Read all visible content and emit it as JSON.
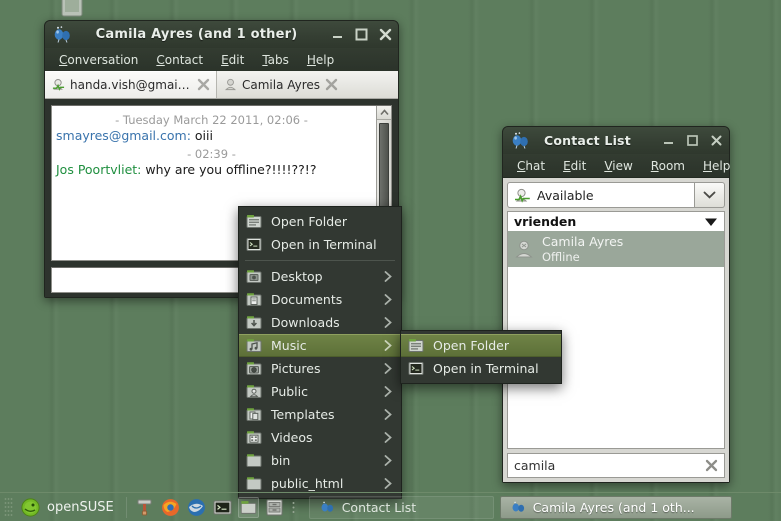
{
  "desktop": {
    "trash_icon": "trash-bin-icon",
    "wallpaper_color": "#5d7d5d"
  },
  "chat_window": {
    "app_icon": "pidgin-balloons-icon",
    "title": "Camila Ayres (and 1 other)",
    "window_buttons": [
      {
        "name": "minimize-button",
        "glyph": "minimize-icon"
      },
      {
        "name": "maximize-button",
        "glyph": "maximize-icon"
      },
      {
        "name": "close-button",
        "glyph": "close-icon"
      }
    ],
    "menus": [
      {
        "accel": "C",
        "rest": "onversation"
      },
      {
        "accel": "C",
        "rest": "ontact",
        "pre": "C",
        "label": "Contact"
      },
      {
        "accel": "E",
        "rest": "dit"
      },
      {
        "accel": "T",
        "rest": "abs"
      },
      {
        "accel": "H",
        "rest": "elp"
      }
    ],
    "menu_labels": [
      "Conversation",
      "Contact",
      "Edit",
      "Tabs",
      "Help"
    ],
    "tabs": [
      {
        "label": "handa.vish@gmail.c...",
        "icon": "account-available-icon",
        "active": true,
        "close_icon": "close-icon"
      },
      {
        "label": "Camila Ayres",
        "icon": "person-offline-icon",
        "active": false,
        "close_icon": "close-icon"
      }
    ],
    "conversation": [
      {
        "type": "timestamp",
        "text": "- Tuesday March 22 2011, 02:06 -"
      },
      {
        "type": "message",
        "nick": "smayres@gmail.com:",
        "nick_color": "#3973ac",
        "text": "oiii"
      },
      {
        "type": "timestamp",
        "text": "- 02:39 -"
      },
      {
        "type": "message",
        "nick": "Jos Poortvliet:",
        "nick_color": "#1f8f3f",
        "text": "why are you offline?!!!!??!?"
      }
    ],
    "scrollbar": {
      "name": "conversation-scrollbar",
      "up_arrow": "chevron-up-icon"
    },
    "input": {
      "name": "message-input",
      "value": "",
      "placeholder": ""
    }
  },
  "contact_window": {
    "app_icon": "pidgin-balloons-icon",
    "title": "Contact List",
    "window_buttons": [
      {
        "name": "minimize-button",
        "glyph": "minimize-icon"
      },
      {
        "name": "maximize-button",
        "glyph": "maximize-icon"
      },
      {
        "name": "close-button",
        "glyph": "close-icon"
      }
    ],
    "menu_labels": [
      "Chat",
      "Edit",
      "View",
      "Room",
      "Help"
    ],
    "status": {
      "icon": "status-available-icon",
      "value": "Available",
      "dropdown_icon": "chevron-down-icon"
    },
    "group": {
      "label": "vrienden",
      "expander_icon": "triangle-down-icon"
    },
    "contacts": [
      {
        "name": "Camila Ayres",
        "status": "Offline",
        "icon": "person-offline-icon",
        "selected": true
      }
    ],
    "search": {
      "value": "camila",
      "placeholder": "",
      "clear_icon": "close-icon"
    }
  },
  "context_menu": {
    "items": [
      {
        "label": "Open Folder",
        "icon": "open-folder-icon",
        "submenu": false,
        "selected": false
      },
      {
        "label": "Open in Terminal",
        "icon": "terminal-icon",
        "submenu": false,
        "selected": false
      },
      {
        "separator": true
      },
      {
        "label": "Desktop",
        "icon": "folder-desktop-icon",
        "submenu": true,
        "selected": false
      },
      {
        "label": "Documents",
        "icon": "folder-documents-icon",
        "submenu": true,
        "selected": false
      },
      {
        "label": "Downloads",
        "icon": "folder-downloads-icon",
        "submenu": true,
        "selected": false
      },
      {
        "label": "Music",
        "icon": "folder-music-icon",
        "submenu": true,
        "selected": true
      },
      {
        "label": "Pictures",
        "icon": "folder-pictures-icon",
        "submenu": true,
        "selected": false
      },
      {
        "label": "Public",
        "icon": "folder-public-icon",
        "submenu": true,
        "selected": false
      },
      {
        "label": "Templates",
        "icon": "folder-templates-icon",
        "submenu": true,
        "selected": false
      },
      {
        "label": "Videos",
        "icon": "folder-videos-icon",
        "submenu": true,
        "selected": false
      },
      {
        "label": "bin",
        "icon": "folder-icon",
        "submenu": true,
        "selected": false
      },
      {
        "label": "public_html",
        "icon": "folder-icon",
        "submenu": true,
        "selected": false
      }
    ]
  },
  "context_submenu": {
    "items": [
      {
        "label": "Open Folder",
        "icon": "open-folder-icon",
        "selected": true
      },
      {
        "label": "Open in Terminal",
        "icon": "terminal-icon",
        "selected": false
      }
    ]
  },
  "taskbar": {
    "start_label": "openSUSE",
    "start_icon": "opensuse-gecko-icon",
    "tray_icons": [
      "package-updater-icon",
      "firefox-icon",
      "thunderbird-icon",
      "terminal-icon",
      "file-manager-icon",
      "archive-icon"
    ],
    "tasks": [
      {
        "label": "Contact List",
        "icon": "pidgin-balloons-icon",
        "active": false
      },
      {
        "label": "Camila Ayres (and 1 oth...",
        "icon": "pidgin-balloons-icon",
        "active": true
      }
    ]
  },
  "colors": {
    "menu_highlight": "#6f8346",
    "contact_highlight": "#9aa79a",
    "nick_blue": "#3973ac",
    "nick_green": "#1f8f3f",
    "desktop_green": "#5d7d5d"
  }
}
